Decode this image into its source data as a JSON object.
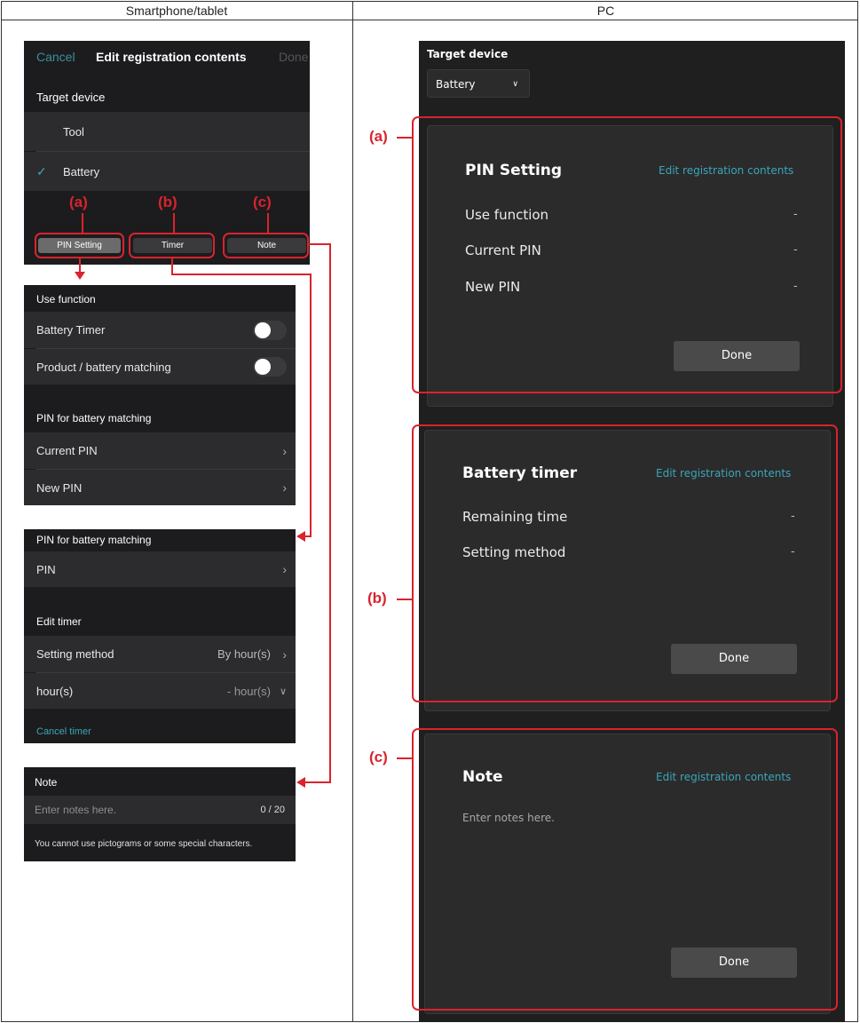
{
  "headers": {
    "left": "Smartphone/tablet",
    "right": "PC"
  },
  "labels": {
    "a": "(a)",
    "b": "(b)",
    "c": "(c)"
  },
  "phone_top": {
    "cancel": "Cancel",
    "title": "Edit registration contents",
    "done": "Done",
    "section": "Target device",
    "options": [
      "Tool",
      "Battery"
    ],
    "check": "✓",
    "tabs": [
      "PIN Setting",
      "Timer",
      "Note"
    ]
  },
  "phone_pin": {
    "section1": "Use function",
    "toggles": [
      "Battery Timer",
      "Product / battery matching"
    ],
    "section2": "PIN for battery matching",
    "items": [
      "Current PIN",
      "New PIN"
    ]
  },
  "phone_timer": {
    "section1": "PIN for battery matching",
    "pin": "PIN",
    "section2": "Edit timer",
    "method_label": "Setting method",
    "method_value": "By hour(s)",
    "hours_label": "hour(s)",
    "hours_value": "- hour(s)",
    "cancel_timer": "Cancel timer"
  },
  "phone_note": {
    "section": "Note",
    "placeholder": "Enter notes here.",
    "counter": "0 / 20",
    "hint": "You cannot use pictograms or some special characters."
  },
  "pc": {
    "target_label": "Target device",
    "target_value": "Battery",
    "card_a": {
      "title": "PIN Setting",
      "edit": "Edit registration contents",
      "rows": [
        "Use function",
        "Current PIN",
        "New PIN"
      ],
      "dash": "-",
      "done": "Done"
    },
    "card_b": {
      "title": "Battery timer",
      "edit": "Edit registration contents",
      "rows": [
        "Remaining time",
        "Setting method"
      ],
      "dash": "-",
      "done": "Done"
    },
    "card_c": {
      "title": "Note",
      "edit": "Edit registration contents",
      "placeholder": "Enter notes here.",
      "done": "Done"
    }
  },
  "colors": {
    "annotation": "#d9232d",
    "link": "#3aa6b9",
    "dark_bg": "#1c1c1e"
  },
  "icons": {
    "check": "checkmark-icon",
    "chevron": "chevron-right-icon",
    "dropdown": "chevron-down-icon"
  }
}
